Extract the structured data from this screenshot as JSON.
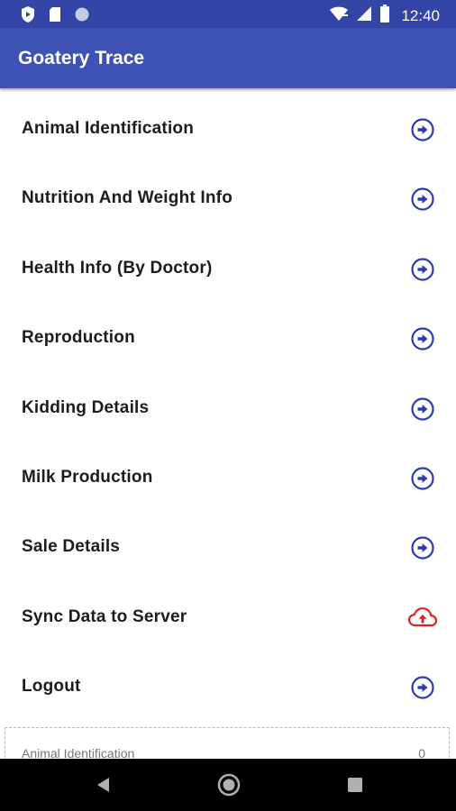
{
  "status_bar": {
    "time": "12:40",
    "left_icons": [
      "shield-icon",
      "sd-card-icon",
      "circle-icon"
    ],
    "right_icons": [
      "wifi-icon",
      "signal-icon",
      "battery-icon"
    ]
  },
  "app_bar": {
    "title": "Goatery Trace"
  },
  "colors": {
    "primary": "#3e51b5",
    "status_bar": "#3346a8",
    "arrow_icon": "#2d3bb0",
    "sync_icon": "#e02020"
  },
  "menu": {
    "items": [
      {
        "label": "Animal Identification",
        "icon": "arrow-circle-right-icon"
      },
      {
        "label": "Nutrition And Weight Info",
        "icon": "arrow-circle-right-icon"
      },
      {
        "label": "Health Info (By Doctor)",
        "icon": "arrow-circle-right-icon"
      },
      {
        "label": "Reproduction",
        "icon": "arrow-circle-right-icon"
      },
      {
        "label": "Kidding Details",
        "icon": "arrow-circle-right-icon"
      },
      {
        "label": "Milk Production",
        "icon": "arrow-circle-right-icon"
      },
      {
        "label": "Sale Details",
        "icon": "arrow-circle-right-icon"
      },
      {
        "label": "Sync Data to Server",
        "icon": "cloud-upload-icon"
      },
      {
        "label": "Logout",
        "icon": "arrow-circle-right-icon"
      }
    ]
  },
  "summary": {
    "label": "Animal Identification",
    "value": "0"
  },
  "nav_bar": {
    "icons": [
      "back-icon",
      "home-icon",
      "recents-icon"
    ]
  }
}
